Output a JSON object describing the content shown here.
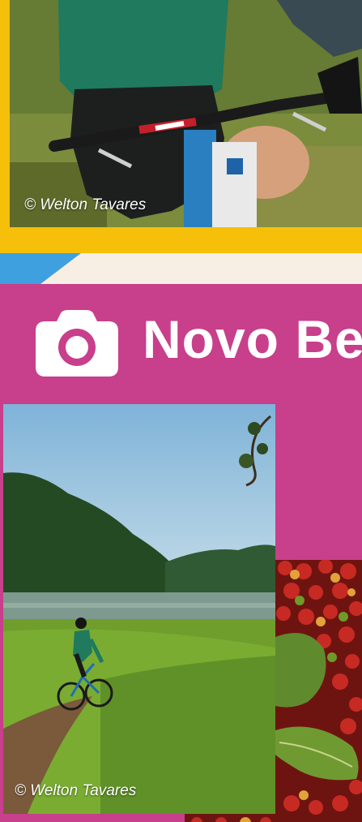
{
  "top_photo": {
    "credit": "© Welton Tavares"
  },
  "brand": {
    "title": "Novo Be",
    "icon": "camera-icon"
  },
  "landscape_photo": {
    "credit": "© Welton Tavares"
  },
  "colors": {
    "frame_yellow": "#f5bf0a",
    "brand_magenta": "#c83f8b",
    "stripe_blue": "#3fa0e0",
    "stripe_cream": "#f7efe4"
  }
}
